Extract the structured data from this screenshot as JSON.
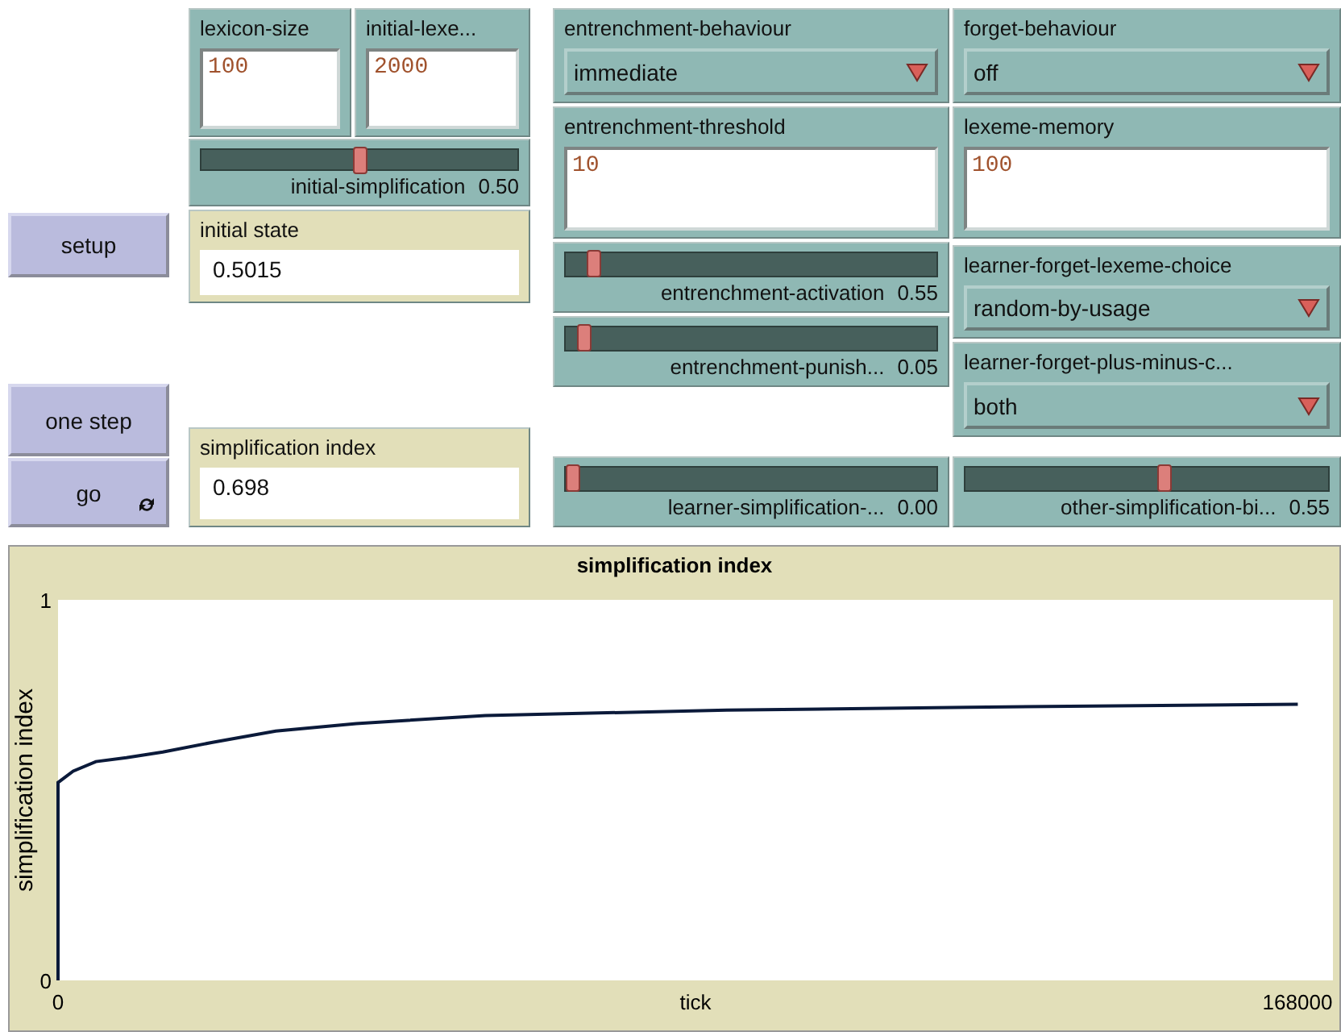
{
  "widgets": [
    {
      "kind": "input",
      "label": "lexicon-size",
      "value": "100"
    },
    {
      "kind": "input",
      "label": "initial-lexe...",
      "value": "2000"
    },
    {
      "kind": "slider",
      "label": "initial-simplification",
      "reading": "0.50",
      "level": 0.5
    },
    {
      "kind": "chooser",
      "label": "entrenchment-behaviour",
      "value": "immediate"
    },
    {
      "kind": "chooser",
      "label": "forget-behaviour",
      "value": "off"
    },
    {
      "kind": "input",
      "label": "entrenchment-threshold",
      "value": "10"
    },
    {
      "kind": "input",
      "label": "lexeme-memory",
      "value": "100"
    },
    {
      "kind": "button",
      "label": "setup",
      "forever": false
    },
    {
      "kind": "monitor",
      "label": "initial state",
      "value": "0.5015"
    },
    {
      "kind": "slider",
      "label": "entrenchment-activation",
      "reading": "0.55",
      "level": 0.06
    },
    {
      "kind": "chooser",
      "label": "learner-forget-lexeme-choice",
      "value": "random-by-usage"
    },
    {
      "kind": "slider",
      "label": "entrenchment-punish...",
      "reading": "0.05",
      "level": 0.03
    },
    {
      "kind": "chooser",
      "label": "learner-forget-plus-minus-c...",
      "value": "both"
    },
    {
      "kind": "button",
      "label": "one step",
      "forever": false
    },
    {
      "kind": "button",
      "label": "go",
      "forever": true
    },
    {
      "kind": "monitor",
      "label": "simplification index",
      "value": "0.698"
    },
    {
      "kind": "slider",
      "label": "learner-simplification-...",
      "reading": "0.00",
      "level": 0
    },
    {
      "kind": "slider",
      "label": "other-simplification-bi...",
      "reading": "0.55",
      "level": 0.55
    }
  ],
  "plot": {
    "title": "simplification index",
    "chart_data": {
      "type": "line",
      "xlabel": "tick",
      "ylabel": "simplification index",
      "xlim": [
        0,
        172760
      ],
      "ylim": [
        0,
        1
      ],
      "xticks": [
        0,
        168000
      ],
      "yticks": [
        0,
        1
      ],
      "x": [
        0,
        0,
        2060,
        5140,
        9250,
        14200,
        20800,
        29500,
        40400,
        57900,
        90600,
        123400,
        168000
      ],
      "series": [
        {
          "color": "#0b1a3a",
          "values": [
            0,
            0.52,
            0.55,
            0.575,
            0.585,
            0.6,
            0.625,
            0.655,
            0.675,
            0.696,
            0.71,
            0.718,
            0.726
          ]
        }
      ]
    }
  }
}
